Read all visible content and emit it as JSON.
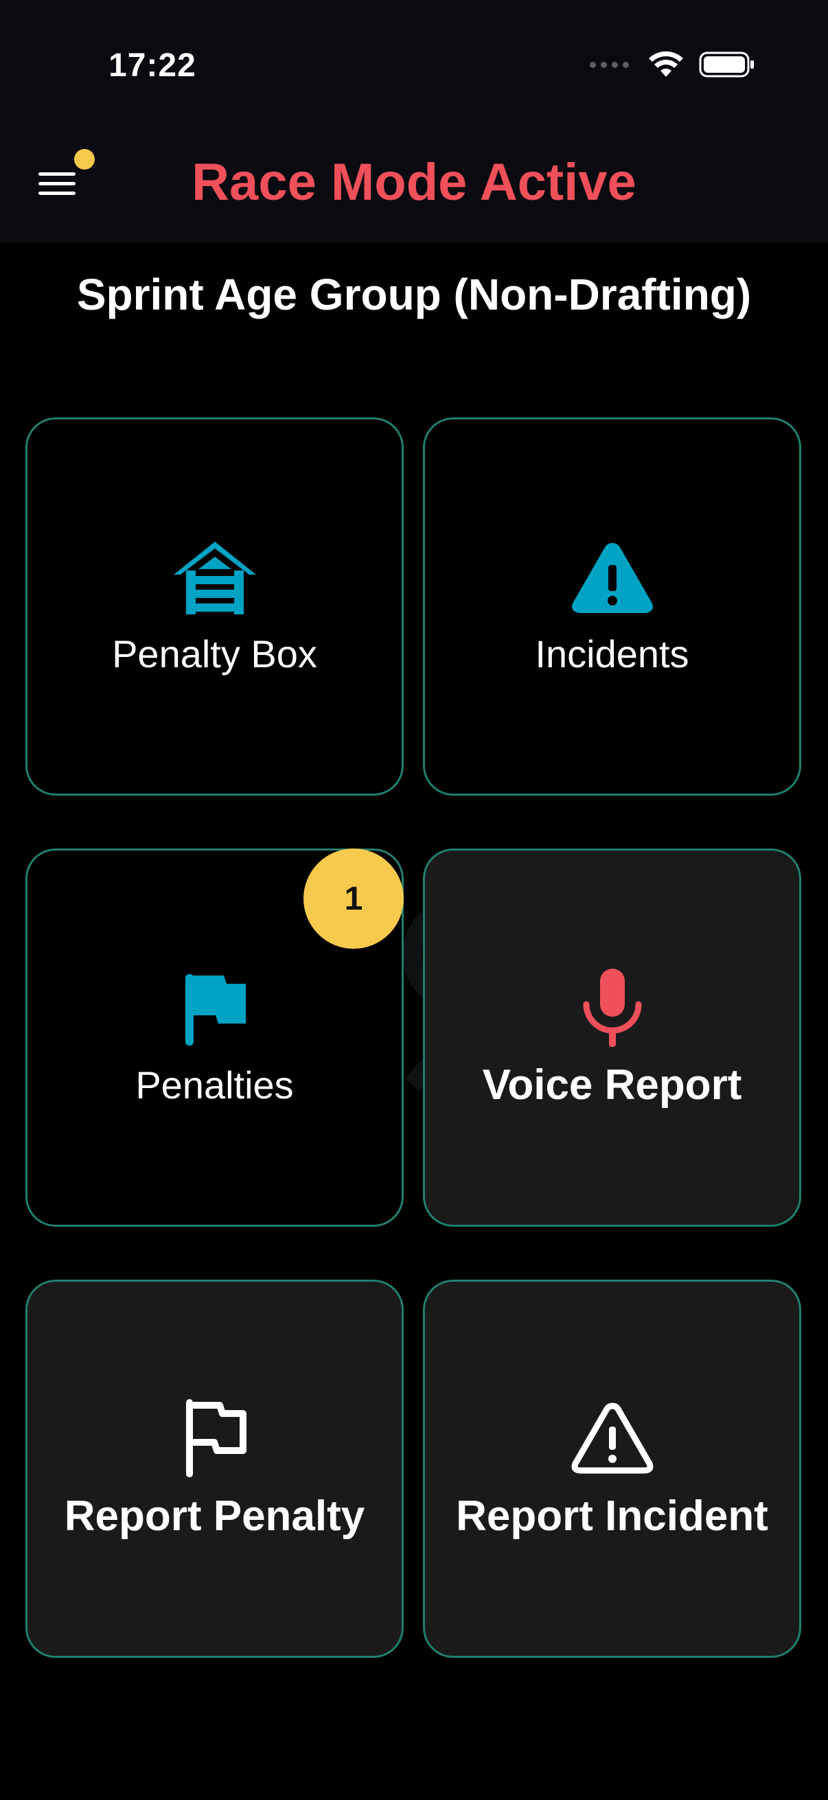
{
  "status_bar": {
    "time": "17:22"
  },
  "header": {
    "title": "Race Mode Active",
    "title_color": "#f0505a",
    "menu_indicator_color": "#f7c94d"
  },
  "event": {
    "name": "Sprint Age Group (Non-Drafting)"
  },
  "tiles": [
    {
      "label": "Penalty Box",
      "icon": "penalty-box-icon",
      "icon_color": "#00a3c4"
    },
    {
      "label": "Incidents",
      "icon": "warning-triangle-icon",
      "icon_color": "#00a3c4"
    },
    {
      "label": "Penalties",
      "icon": "flag-icon",
      "icon_color": "#00a3c4",
      "badge": "1"
    },
    {
      "label": "Voice Report",
      "icon": "microphone-icon",
      "icon_color": "#f0505a"
    },
    {
      "label": "Report Penalty",
      "icon": "flag-outline-icon",
      "icon_color": "#ffffff"
    },
    {
      "label": "Report Incident",
      "icon": "warning-triangle-outline-icon",
      "icon_color": "#ffffff"
    }
  ],
  "colors": {
    "tile_border": "#1f7f6e",
    "badge": "#f7c94d"
  }
}
